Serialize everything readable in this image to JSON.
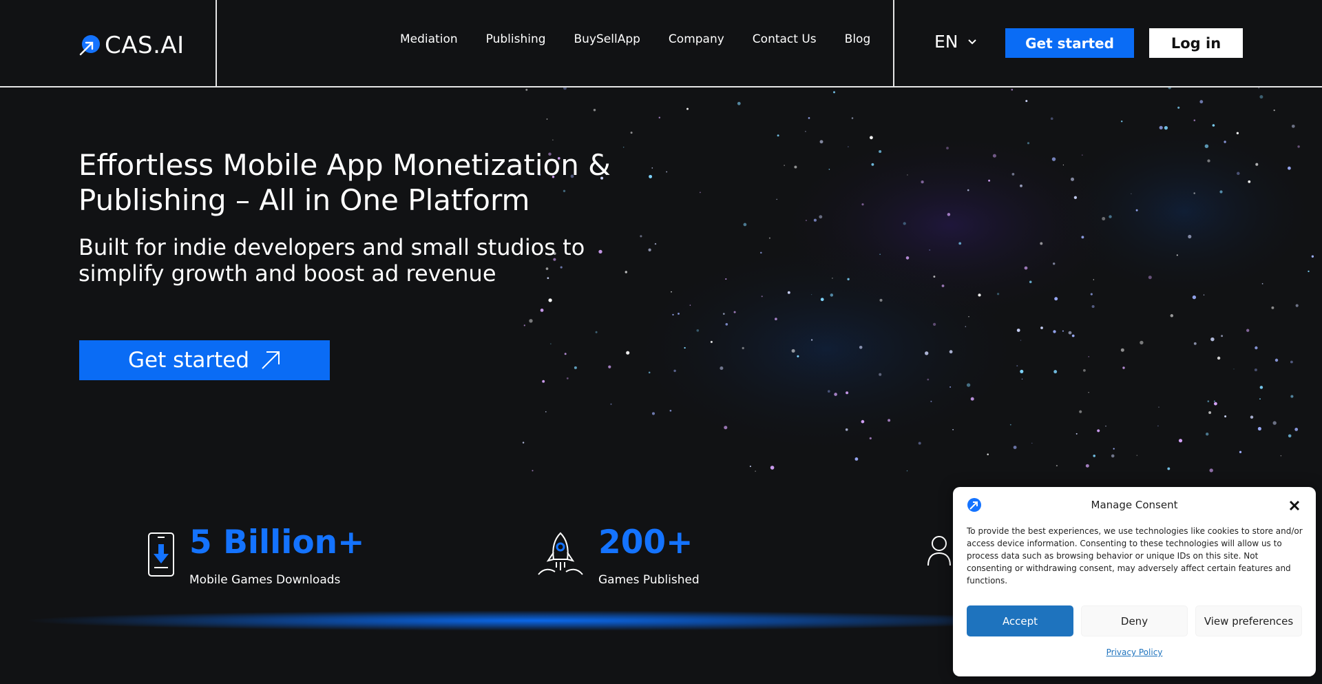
{
  "brand": {
    "name": "CAS.AI",
    "accent": "#0a6cf5"
  },
  "nav": {
    "items": [
      {
        "label": "Mediation"
      },
      {
        "label": "Publishing"
      },
      {
        "label": "BuySellApp"
      },
      {
        "label": "Company"
      },
      {
        "label": "Contact Us"
      },
      {
        "label": "Blog"
      }
    ]
  },
  "header": {
    "language": "EN",
    "get_started_label": "Get started",
    "login_label": "Log in"
  },
  "hero": {
    "title": "Effortless Mobile App Monetization & Publishing – All in One Platform",
    "subtitle": "Built for indie developers and small studios to simplify growth and boost ad revenue",
    "cta_label": "Get started"
  },
  "stats": [
    {
      "value": "5 Billion+",
      "label": "Mobile Games Downloads",
      "icon": "phone-download-icon"
    },
    {
      "value": "200+",
      "label": "Games Published",
      "icon": "rocket-icon"
    },
    {
      "value": "",
      "label": "",
      "icon": "users-icon"
    }
  ],
  "consent": {
    "title": "Manage Consent",
    "text": "To provide the best experiences, we use technologies like cookies to store and/or access device information. Consenting to these technologies will allow us to process data such as browsing behavior or unique IDs on this site. Not consenting or withdrawing consent, may adversely affect certain features and functions.",
    "accept_label": "Accept",
    "deny_label": "Deny",
    "preferences_label": "View preferences",
    "privacy_link": "Privacy Policy",
    "accept_color": "#1e73be"
  }
}
